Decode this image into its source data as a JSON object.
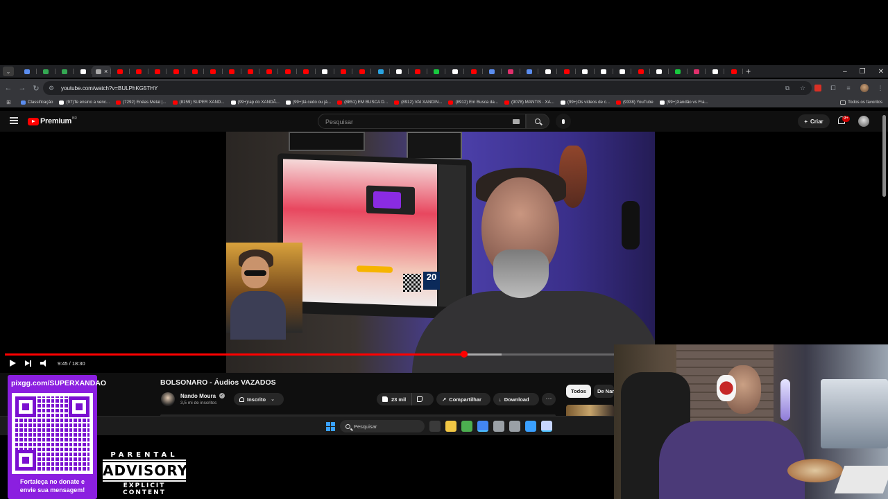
{
  "browser": {
    "tab_count": 39,
    "active_tab_index": 4,
    "tab_favicon_colors": [
      "#5b8def",
      "#34a853",
      "#34a853",
      "#ffffff",
      "#aaaaaa",
      "#ff0000",
      "#ff0000",
      "#ff0000",
      "#ff0000",
      "#ff0000",
      "#ff0000",
      "#ff0000",
      "#ff0000",
      "#ff0000",
      "#ff0000",
      "#ff0000",
      "#ffffff",
      "#ff0000",
      "#ff0000",
      "#2aa3e0",
      "#ffffff",
      "#ff0000",
      "#18c93f",
      "#ffffff",
      "#ff0000",
      "#5b8def",
      "#e1306c",
      "#5b8def",
      "#ffffff",
      "#ff0000",
      "#ffffff",
      "#ffffff",
      "#ffffff",
      "#ff0000",
      "#ffffff",
      "#18c93f",
      "#e1306c",
      "#ffffff",
      "#ff0000"
    ],
    "new_tab_label": "+",
    "window_controls": [
      "–",
      "❐",
      "✕"
    ],
    "url": "youtube.com/watch?v=BULPhKG5THY",
    "bookmarks": [
      {
        "label": "Classificação",
        "color": "#5b8def"
      },
      {
        "label": "(97)Te ensino a venc...",
        "color": "#ffffff"
      },
      {
        "label": "(7292) Enéas Metal |...",
        "color": "#ff0000"
      },
      {
        "label": "(8159) SUPER XAND...",
        "color": "#ff0000"
      },
      {
        "label": "(99+)rap do XANDÃ...",
        "color": "#ffffff"
      },
      {
        "label": "(99+)tá cedo ou já...",
        "color": "#ffffff"
      },
      {
        "label": "(8851) EM BUSCA D...",
        "color": "#ff0000"
      },
      {
        "label": "(8912) VAI XANDIN...",
        "color": "#ff0000"
      },
      {
        "label": "(8912) Em Busca da...",
        "color": "#ff0000"
      },
      {
        "label": "(9078) MANTIS · XA...",
        "color": "#ff0000"
      },
      {
        "label": "(99+)Os vídeos de c...",
        "color": "#ffffff"
      },
      {
        "label": "(9338) YouTube",
        "color": "#ff0000"
      },
      {
        "label": "(99+)Xandão vs Fra...",
        "color": "#ffffff"
      }
    ],
    "all_bookmarks_label": "Todos os favoritos"
  },
  "youtube": {
    "logo_word": "Premium",
    "logo_country": "BR",
    "search_placeholder": "Pesquisar",
    "create_label": "Criar",
    "notification_count": "9+",
    "player": {
      "time_current": "9:45",
      "time_total": "18:30",
      "time_display": "9:45 / 18:30",
      "played_fraction": 0.527,
      "loaded_fraction": 0.57,
      "inset_number": "20"
    },
    "video_title": "BOLSONARO - Áudios VAZADOS",
    "channel_name": "Nando Moura",
    "channel_subs": "3,5 mi de inscritos",
    "subscribed_label": "Inscrito",
    "like_count": "23 mil",
    "share_label": "Compartilhar",
    "download_label": "Download",
    "more_label": "···",
    "chips": [
      "Todos",
      "De Nando Moura"
    ]
  },
  "taskbar": {
    "search_label": "Pesquisar",
    "app_colors": [
      "#3a3a3a",
      "#f2c744",
      "#4caf50",
      "#4285f4",
      "#9aa0a6",
      "#9aa0a6",
      "#3aa0ff",
      "#c8d6ff"
    ]
  },
  "overlay": {
    "donate_url": "pixgg.com/SUPERXANDAO",
    "donate_message_line1": "Fortaleça no donate e",
    "donate_message_line2": "envie sua mensagem!",
    "advisory_line1": "PARENTAL",
    "advisory_line2": "ADVISORY",
    "advisory_line3": "EXPLICIT CONTENT"
  }
}
